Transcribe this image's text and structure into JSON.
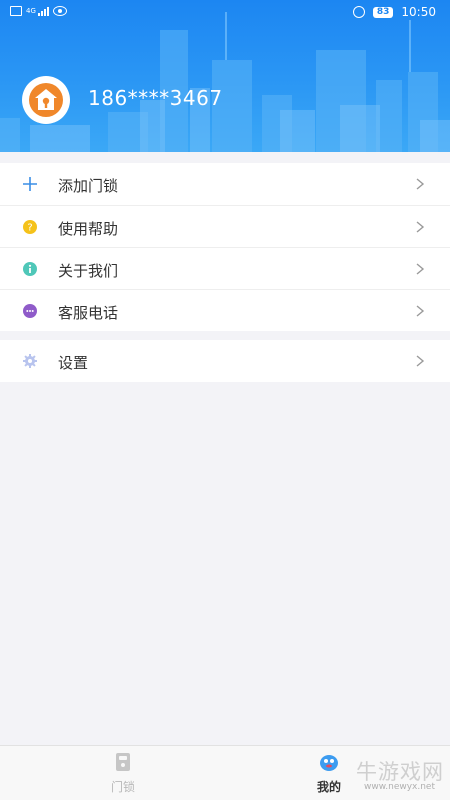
{
  "status_bar": {
    "network": "4G",
    "battery": "83",
    "time": "10:50"
  },
  "profile": {
    "phone": "186****3467"
  },
  "menu": {
    "items": [
      {
        "label": "添加门锁",
        "icon": "plus-icon"
      },
      {
        "label": "使用帮助",
        "icon": "help-icon"
      },
      {
        "label": "关于我们",
        "icon": "info-icon"
      },
      {
        "label": "客服电话",
        "icon": "chat-icon"
      }
    ],
    "settings": {
      "label": "设置",
      "icon": "gear-icon"
    }
  },
  "tabbar": {
    "tabs": [
      {
        "label": "门锁",
        "icon": "door-lock-icon",
        "active": false
      },
      {
        "label": "我的",
        "icon": "mascot-icon",
        "active": true
      }
    ]
  },
  "watermark": {
    "text": "牛游戏网",
    "url": "www.newyx.net"
  },
  "colors": {
    "header_blue": "#1c86f2",
    "help_yellow": "#f5c21a",
    "info_teal": "#4fc7b8",
    "chat_purple": "#8f5bc9",
    "avatar_orange": "#f0872a"
  }
}
